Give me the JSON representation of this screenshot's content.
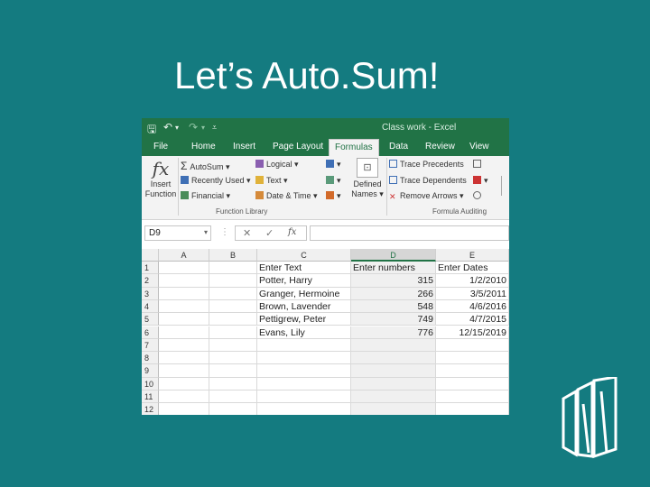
{
  "slide": {
    "title": "Let’s Auto.Sum!"
  },
  "window": {
    "title": "Class work - Excel"
  },
  "colors": {
    "background": "#147b80",
    "excel_green": "#217346",
    "ribbon": "#f3f3f3"
  },
  "quick_access": {
    "icons": [
      "save-icon",
      "undo-icon",
      "redo-icon",
      "customize-icon"
    ]
  },
  "tabs": [
    {
      "label": "File"
    },
    {
      "label": "Home"
    },
    {
      "label": "Insert"
    },
    {
      "label": "Page Layout"
    },
    {
      "label": "Formulas",
      "active": true
    },
    {
      "label": "Data"
    },
    {
      "label": "Review"
    },
    {
      "label": "View"
    }
  ],
  "ribbon": {
    "insert_function": {
      "line1": "Insert",
      "line2": "Function",
      "icon": "fx-icon"
    },
    "library": {
      "autosum": "AutoSum",
      "recently_used": "Recently Used",
      "financial": "Financial",
      "logical": "Logical",
      "text": "Text",
      "date_time": "Date & Time"
    },
    "defined_names": {
      "line1": "Defined",
      "line2": "Names"
    },
    "auditing": {
      "trace_precedents": "Trace Precedents",
      "trace_dependents": "Trace Dependents",
      "remove_arrows": "Remove Arrows"
    },
    "group_labels": {
      "function_library": "Function Library",
      "formula_auditing": "Formula Auditing"
    }
  },
  "formula_bar": {
    "name_box": "D9",
    "cancel": "✕",
    "enter": "✓",
    "fx": "fx",
    "formula": ""
  },
  "columns": [
    "A",
    "B",
    "C",
    "D",
    "E"
  ],
  "rows": [
    "1",
    "2",
    "3",
    "4",
    "5",
    "6",
    "7",
    "8",
    "9",
    "10",
    "11",
    "12"
  ],
  "sheet": {
    "headers": {
      "c": "Enter Text",
      "d": "Enter numbers",
      "e": "Enter Dates"
    },
    "data": [
      {
        "c": "Potter, Harry",
        "d": "315",
        "e": "1/2/2010"
      },
      {
        "c": "Granger, Hermoine",
        "d": "266",
        "e": "3/5/2011"
      },
      {
        "c": "Brown, Lavender",
        "d": "548",
        "e": "4/6/2016"
      },
      {
        "c": "Pettigrew, Peter",
        "d": "749",
        "e": "4/7/2015"
      },
      {
        "c": "Evans, Lily",
        "d": "776",
        "e": "12/15/2019"
      }
    ]
  }
}
